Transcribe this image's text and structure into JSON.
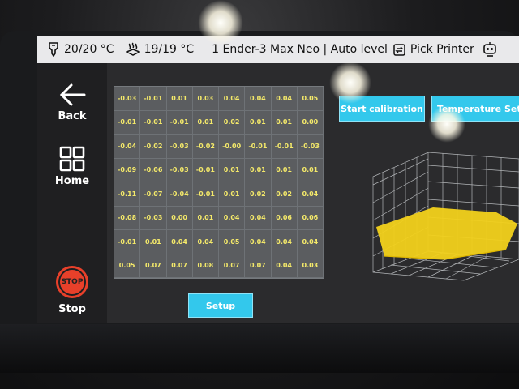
{
  "statusbar": {
    "nozzle_temp": "20/20 °C",
    "bed_temp": "19/19 °C",
    "printer_name": "1 Ender-3 Max Neo | Auto level",
    "pick_printer_label": "Pick Printer"
  },
  "nav": {
    "back_label": "Back",
    "home_label": "Home",
    "stop_label": "Stop",
    "stop_icon_text": "STOP"
  },
  "buttons": {
    "start_calibration": "Start calibration",
    "temperature_setup": "Temperature Setup",
    "setup": "Setup"
  },
  "mesh": [
    [
      "-0.03",
      "-0.01",
      "0.01",
      "0.03",
      "0.04",
      "0.04",
      "0.04",
      "0.05"
    ],
    [
      "-0.01",
      "-0.01",
      "-0.01",
      "0.01",
      "0.02",
      "0.01",
      "0.01",
      "0.00"
    ],
    [
      "-0.04",
      "-0.02",
      "-0.03",
      "-0.02",
      "-0.00",
      "-0.01",
      "-0.01",
      "-0.03"
    ],
    [
      "-0.09",
      "-0.06",
      "-0.03",
      "-0.01",
      "0.01",
      "0.01",
      "0.01",
      "0.01"
    ],
    [
      "-0.11",
      "-0.07",
      "-0.04",
      "-0.01",
      "0.01",
      "0.02",
      "0.02",
      "0.04"
    ],
    [
      "-0.08",
      "-0.03",
      "0.00",
      "0.01",
      "0.04",
      "0.04",
      "0.06",
      "0.06"
    ],
    [
      "-0.01",
      "0.01",
      "0.04",
      "0.04",
      "0.05",
      "0.04",
      "0.04",
      "0.04"
    ],
    [
      "0.05",
      "0.07",
      "0.07",
      "0.08",
      "0.07",
      "0.07",
      "0.04",
      "0.03"
    ]
  ],
  "colors": {
    "accent": "#33c8ec",
    "mesh_text": "#f4e96a",
    "surface": "#f2d11b",
    "stop": "#e8402a"
  }
}
